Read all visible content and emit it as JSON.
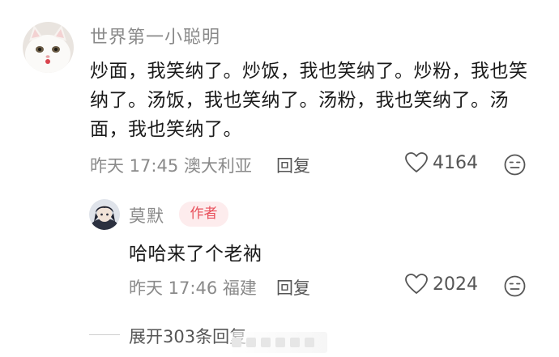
{
  "comment": {
    "username": "世界第一小聪明",
    "text": "炒面，我笑纳了。炒饭，我也笑纳了。炒粉，我也笑纳了。汤饭，我也笑纳了。汤粉，我也笑纳了。汤面，我也笑纳了。",
    "meta": "昨天 17:45 澳大利亚",
    "reply_label": "回复",
    "likes": "4164",
    "avatar_icon": "white-cat-avatar",
    "like_icon": "heart-outline-icon",
    "emoji_icon": "neutral-face-icon"
  },
  "reply": {
    "username": "莫默",
    "badge": "作者",
    "text": "哈哈来了个老衲",
    "meta": "昨天 17:46 福建",
    "reply_label": "回复",
    "likes": "2024",
    "avatar_icon": "anime-character-avatar",
    "like_icon": "heart-outline-icon",
    "emoji_icon": "neutral-face-icon"
  },
  "expand": {
    "label": "展开303条回复"
  },
  "colors": {
    "primary_text": "#1a1a1a",
    "secondary_text": "#8a8a8a",
    "action_text": "#555555",
    "badge_bg": "#fdeced",
    "badge_text": "#e8505b"
  }
}
